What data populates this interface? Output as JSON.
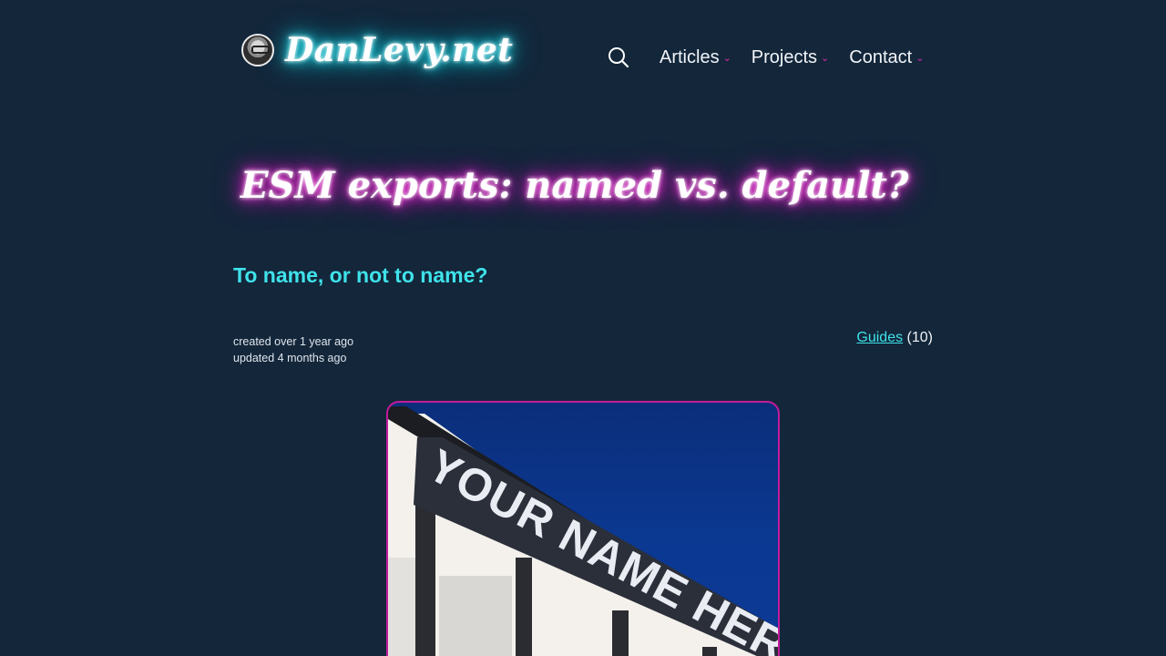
{
  "header": {
    "site_name": "DanLevy.net",
    "nav": [
      {
        "label": "Articles"
      },
      {
        "label": "Projects"
      },
      {
        "label": "Contact"
      }
    ],
    "chevron": "⌄"
  },
  "article": {
    "title": "ESM exports: named vs. default?",
    "subtitle": "To name, or not to name?",
    "created": "created over 1 year ago",
    "updated": "updated 4 months ago",
    "category_label": "Guides",
    "category_count": "(10)"
  },
  "hero": {
    "banner_text": "YOUR NAME HERE"
  },
  "colors": {
    "background": "#13263a",
    "cyan_accent": "#3fe2ea",
    "magenta_accent": "#e02ba8"
  },
  "icons": {
    "search": "search-icon",
    "avatar": "avatar"
  }
}
